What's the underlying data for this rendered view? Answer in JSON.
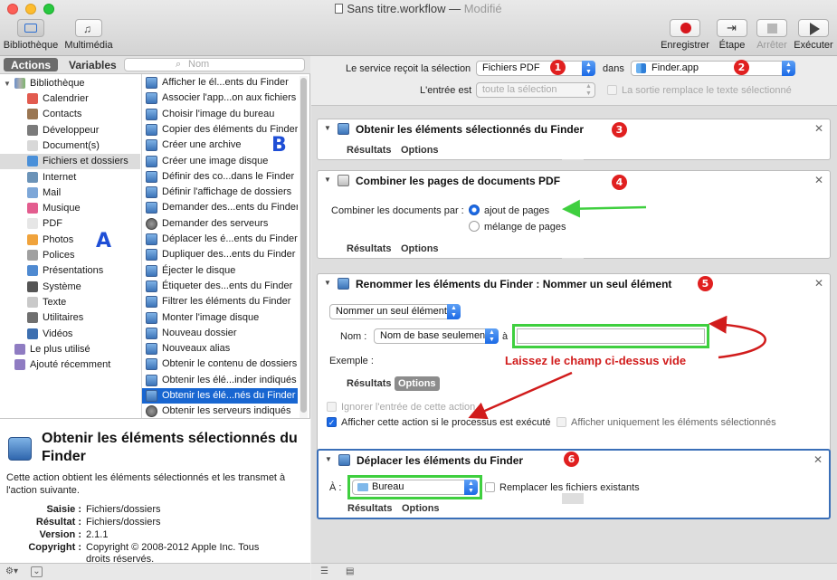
{
  "window": {
    "title": "Sans titre.workflow",
    "status": "Modifié",
    "traffic": [
      "close-button",
      "minimize-button",
      "zoom-button"
    ]
  },
  "toolbar": {
    "library_label": "Bibliothèque",
    "media_label": "Multimédia",
    "record_label": "Enregistrer",
    "step_label": "Étape",
    "stop_label": "Arrêter",
    "run_label": "Exécuter"
  },
  "left": {
    "tab_actions": "Actions",
    "tab_variables": "Variables",
    "search_placeholder": "Nom",
    "library_root": "Bibliothèque",
    "library": [
      {
        "label": "Calendrier",
        "icon": "calendar-icon",
        "color": "#e25b4f"
      },
      {
        "label": "Contacts",
        "icon": "contacts-icon",
        "color": "#9a7652"
      },
      {
        "label": "Développeur",
        "icon": "developer-icon",
        "color": "#7b7b7b"
      },
      {
        "label": "Document(s)",
        "icon": "document-icon",
        "color": "#d8d8d8"
      },
      {
        "label": "Fichiers et dossiers",
        "icon": "finder-icon",
        "color": "#4a90d9"
      },
      {
        "label": "Internet",
        "icon": "globe-icon",
        "color": "#6b93b8"
      },
      {
        "label": "Mail",
        "icon": "mail-icon",
        "color": "#7da7d8"
      },
      {
        "label": "Musique",
        "icon": "music-icon",
        "color": "#e35d8f"
      },
      {
        "label": "PDF",
        "icon": "pdf-icon",
        "color": "#e6e6e6"
      },
      {
        "label": "Photos",
        "icon": "photos-icon",
        "color": "#f0a33c"
      },
      {
        "label": "Polices",
        "icon": "fonts-icon",
        "color": "#a0a0a0"
      },
      {
        "label": "Présentations",
        "icon": "presentation-icon",
        "color": "#4f8ad1"
      },
      {
        "label": "Système",
        "icon": "system-icon",
        "color": "#555555"
      },
      {
        "label": "Texte",
        "icon": "text-icon",
        "color": "#c9c9c9"
      },
      {
        "label": "Utilitaires",
        "icon": "utilities-icon",
        "color": "#6f6f6f"
      },
      {
        "label": "Vidéos",
        "icon": "video-icon",
        "color": "#3d6fb0"
      }
    ],
    "library_extra": [
      {
        "label": "Le plus utilisé",
        "icon": "most-used-icon",
        "color": "#8f7cc2"
      },
      {
        "label": "Ajouté récemment",
        "icon": "recent-icon",
        "color": "#8f7cc2"
      }
    ],
    "actions": [
      "Afficher le él...ents du Finder",
      "Associer l'app...on aux fichiers",
      "Choisir l'image du bureau",
      "Copier des éléments du Finder",
      "Créer une archive",
      "Créer une image disque",
      "Définir des co...dans le Finder",
      "Définir l'affichage de dossiers",
      "Demander des...ents du Finder",
      "Demander des serveurs",
      "Déplacer les é...ents du Finder",
      "Dupliquer des...ents du Finder",
      "Éjecter le disque",
      "Étiqueter des...ents du Finder",
      "Filtrer les éléments du Finder",
      "Monter l'image disque",
      "Nouveau dossier",
      "Nouveaux alias",
      "Obtenir le contenu de dossiers",
      "Obtenir les élé...inder indiqués",
      "Obtenir les élé...nés du Finder",
      "Obtenir les serveurs indiqués"
    ],
    "selected_action_index": 20,
    "annot_a": "A",
    "annot_b": "B",
    "desc": {
      "title": "Obtenir les éléments sélectionnés du Finder",
      "text": "Cette action obtient les éléments sélectionnés et les transmet à l'action suivante.",
      "input_k": "Saisie :",
      "input_v": "Fichiers/dossiers",
      "result_k": "Résultat :",
      "result_v": "Fichiers/dossiers",
      "version_k": "Version :",
      "version_v": "2.1.1",
      "copyright_k": "Copyright :",
      "copyright_v1": "Copyright © 2008-2012 Apple Inc. Tous",
      "copyright_v2": "droits réservés."
    }
  },
  "service": {
    "receives_label": "Le service reçoit la sélection",
    "receives_value": "Fichiers PDF",
    "in_label": "dans",
    "in_value": "Finder.app",
    "input_label": "L'entrée est",
    "input_value": "toute la sélection",
    "replace_label": "La sortie remplace le texte sélectionné"
  },
  "badges": [
    "1",
    "2",
    "3",
    "4",
    "5",
    "6"
  ],
  "cards": {
    "c1_title": "Obtenir les éléments sélectionnés du Finder",
    "c2_title": "Combiner les pages de documents PDF",
    "c2_combine_label": "Combiner les documents par :",
    "c2_opt1": "ajout de pages",
    "c2_opt2": "mélange de pages",
    "c3_title": "Renommer les éléments du Finder : Nommer un seul élément",
    "c3_mode": "Nommer un seul élément",
    "c3_name_label": "Nom :",
    "c3_name_mode": "Nom de base seulement",
    "c3_to_label": "à",
    "c3_name_value": "",
    "c3_example_label": "Exemple :",
    "c3_ignore": "Ignorer l'entrée de cette action",
    "c3_show_when_run": "Afficher cette action si le processus est exécuté",
    "c3_show_selected": "Afficher uniquement les éléments sélectionnés",
    "c4_title": "Déplacer les éléments du Finder",
    "c4_to_label": "À :",
    "c4_to_value": "Bureau",
    "c4_replace": "Remplacer les fichiers existants",
    "tab_results": "Résultats",
    "tab_options": "Options"
  },
  "annotation_text": "Laissez le champ ci-dessus vide",
  "colors": {
    "accent": "#1b6ae6",
    "badge": "#e02020",
    "highlight": "#3fcf3f",
    "annot_blue": "#1f4fd6"
  }
}
